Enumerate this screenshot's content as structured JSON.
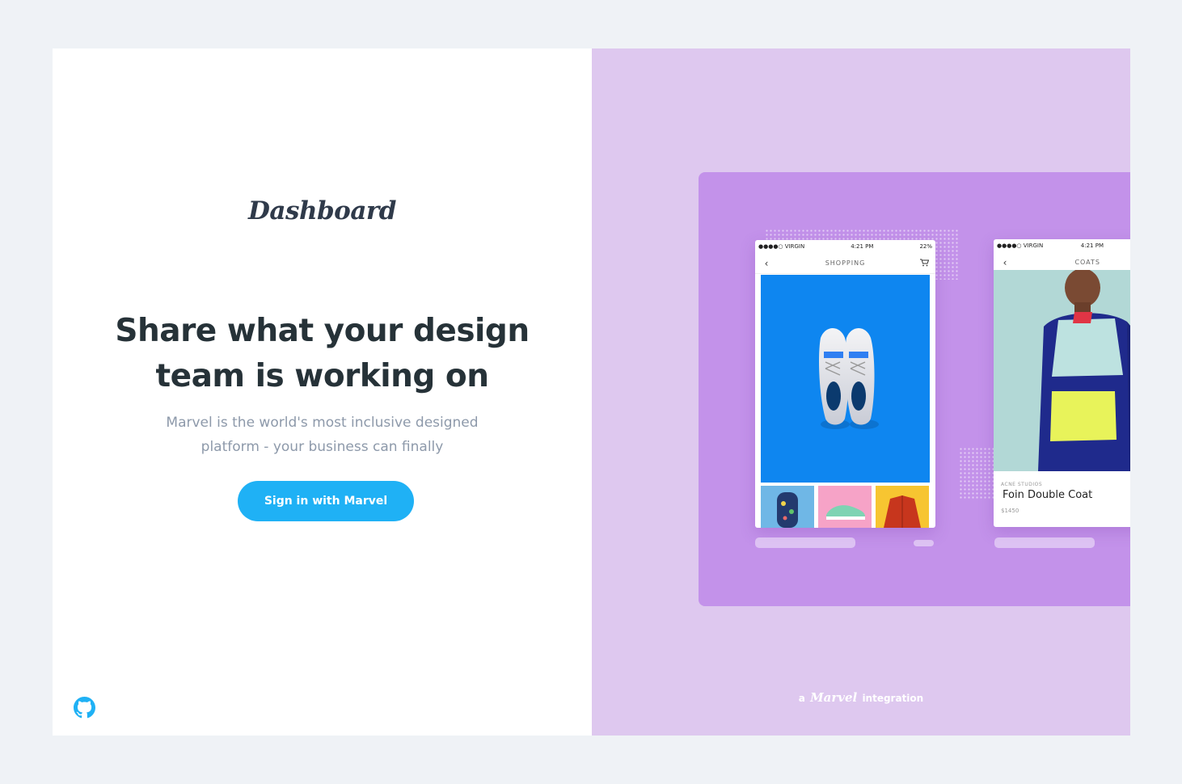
{
  "logo": {
    "text": "Dashboard"
  },
  "hero": {
    "headline_line1": "Share what your design",
    "headline_line2": "team is working on",
    "subtext_line1": "Marvel is the world's most inclusive designed",
    "subtext_line2": "platform - your business can finally"
  },
  "signin_button": {
    "label": "Sign in with Marvel"
  },
  "footer": {
    "github_icon": "github-icon"
  },
  "colors": {
    "page_bg": "#eff2f6",
    "accent": "#1fb1f5",
    "panel_bg": "#dec8ef",
    "preview_bg": "#c392ea"
  },
  "preview": {
    "phone1": {
      "carrier": "●●●●○ VIRGIN",
      "time": "4:21 PM",
      "battery": "22%",
      "title": "SHOPPING",
      "back_icon": "chevron-left-icon",
      "cart_icon": "cart-icon"
    },
    "phone2": {
      "carrier": "●●●●○ VIRGIN",
      "time": "4:21 PM",
      "title": "COATS",
      "brand": "ACNE STUDIOS",
      "product": "Foin Double Coat",
      "price": "$1450"
    }
  },
  "integration": {
    "prefix": "a",
    "brand": "Marvel",
    "suffix": "integration"
  }
}
